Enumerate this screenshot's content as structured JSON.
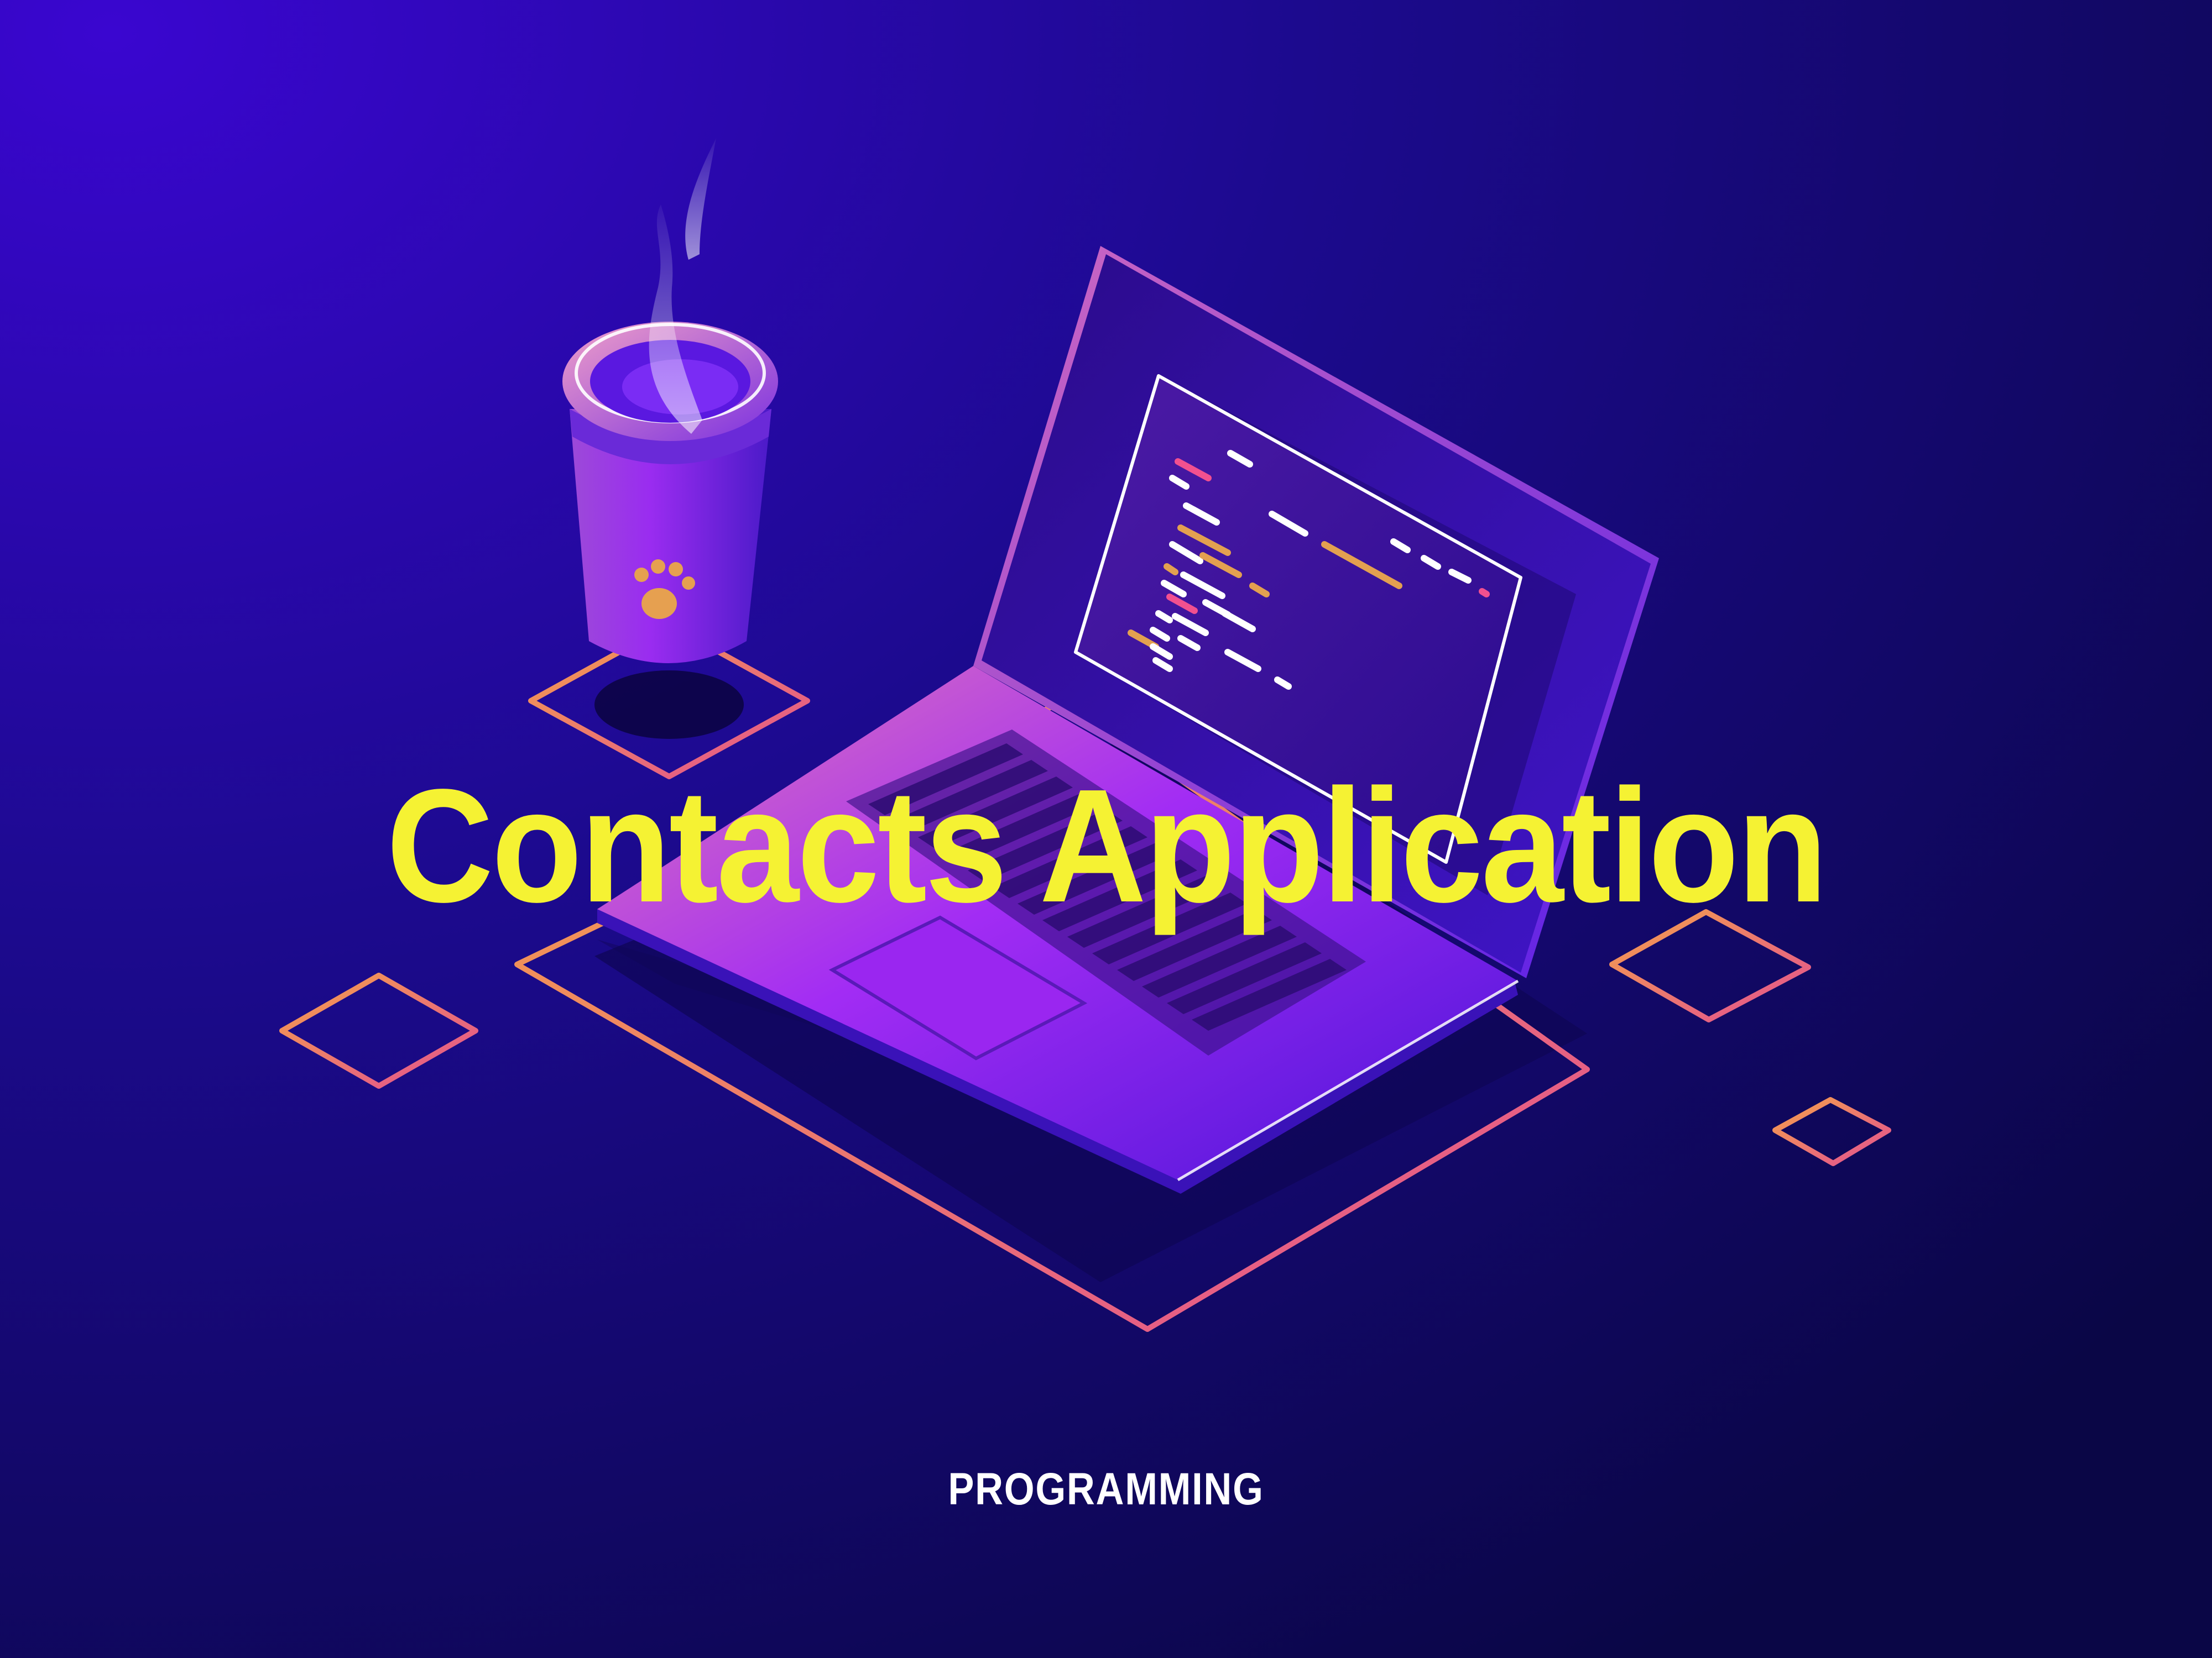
{
  "hero": {
    "title": "Contacts Application",
    "caption": "PROGRAMMING"
  },
  "colors": {
    "background_top": "#3305c4",
    "background_bottom": "#0a0648",
    "title": "#f5f233",
    "caption": "#ffffff",
    "outline_gradient_start": "#f29a4a",
    "outline_gradient_end": "#e2508f",
    "device_purple": "#a02cf6",
    "code_pink": "#f2508f",
    "code_orange": "#e3a050"
  },
  "icons": [
    "laptop-icon",
    "coffee-cup-icon",
    "paw-icon",
    "steam-icon",
    "diamond-outline-icon"
  ]
}
